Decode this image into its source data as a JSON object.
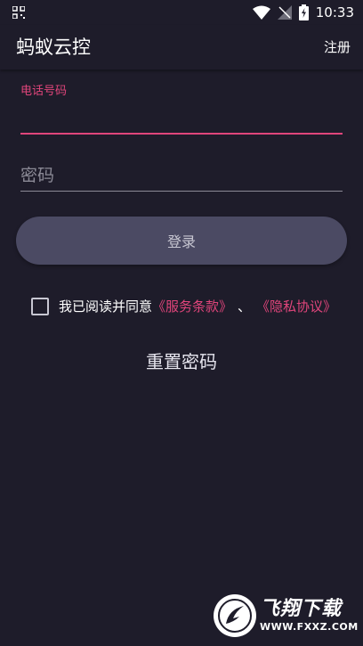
{
  "status_bar": {
    "time": "10:33",
    "icons": [
      "qr-icon",
      "wifi-icon",
      "no-sim-icon",
      "battery-charging-icon"
    ]
  },
  "app_bar": {
    "title": "蚂蚁云控",
    "register_label": "注册"
  },
  "form": {
    "phone_label": "电话号码",
    "phone_value": "",
    "password_placeholder": "密码",
    "password_value": "",
    "login_label": "登录"
  },
  "agreement": {
    "checked": false,
    "prefix": "我已阅读并同意",
    "terms_link": "《服务条款》",
    "separator": "、",
    "privacy_link": "《隐私协议》"
  },
  "reset_password_label": "重置密码",
  "watermark": {
    "name": "飞翔下载",
    "url": "WWW.FXXZ.COM"
  },
  "colors": {
    "background": "#1e1c2a",
    "accent": "#e0457b",
    "button": "#4b4a63"
  }
}
